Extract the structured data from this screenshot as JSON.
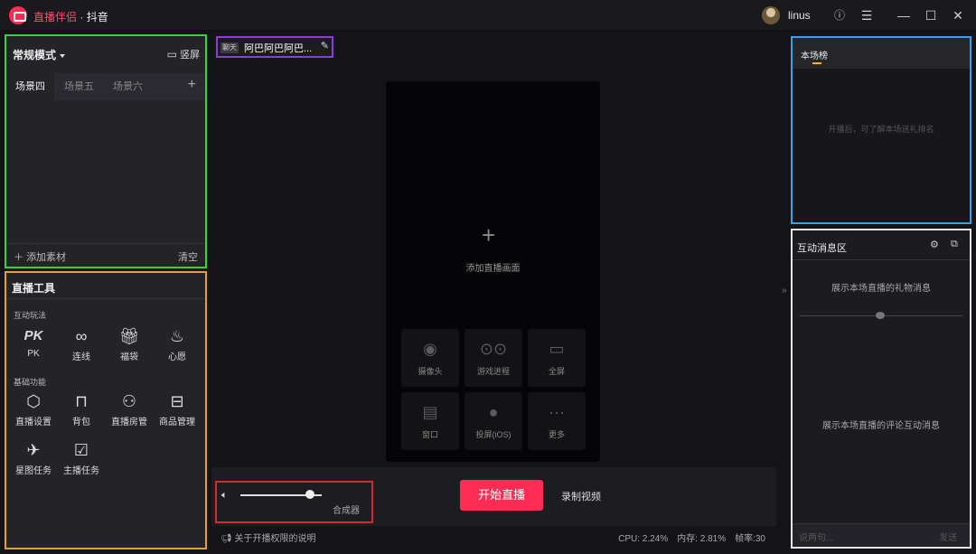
{
  "titlebar": {
    "app_name": "直播伴侣",
    "separator": " · ",
    "platform": "抖音",
    "username": "linus",
    "icons": [
      "help-icon",
      "menu-icon",
      "minimize-icon",
      "maximize-icon",
      "close-icon"
    ]
  },
  "scene": {
    "mode": "常规模式",
    "portrait_label": "竖屏",
    "tabs": [
      "场景四",
      "场景五",
      "场景六"
    ],
    "add_material": "添加素材",
    "clear": "清空"
  },
  "tools": {
    "title": "直播工具",
    "section_interactive": "互动玩法",
    "section_basic": "基础功能",
    "interactive": [
      {
        "label": "PK",
        "icon": "pk-icon"
      },
      {
        "label": "连线",
        "icon": "link-icon"
      },
      {
        "label": "福袋",
        "icon": "gift-bag-icon"
      },
      {
        "label": "心愿",
        "icon": "wish-icon"
      }
    ],
    "basic": [
      {
        "label": "直播设置",
        "icon": "settings-icon"
      },
      {
        "label": "背包",
        "icon": "backpack-icon"
      },
      {
        "label": "直播房管",
        "icon": "room-admin-icon"
      },
      {
        "label": "商品管理",
        "icon": "store-icon"
      },
      {
        "label": "星图任务",
        "icon": "star-task-icon"
      },
      {
        "label": "主播任务",
        "icon": "anchor-task-icon"
      }
    ]
  },
  "live_title": {
    "badge": "聊天",
    "title": "阿巴阿巴阿巴..."
  },
  "preview": {
    "add_scene": "添加直播画面",
    "sources": [
      "摄像头",
      "游戏进程",
      "全屏",
      "窗口",
      "投屏(iOS)",
      "更多"
    ]
  },
  "controls": {
    "mixer": "合成器",
    "volume_level": 0.85,
    "go_live": "开始直播",
    "record": "录制视频"
  },
  "status": {
    "notice": "关于开播权限的说明",
    "cpu": "CPU: 2.24%",
    "memory": "内存: 2.81%",
    "fps": "帧率:30"
  },
  "rank": {
    "title": "本场榜",
    "empty": "开播后，可了解本场送礼排名"
  },
  "messages": {
    "title": "互动消息区",
    "gift_note": "展示本场直播的礼物消息",
    "comment_note": "展示本场直播的评论互动消息",
    "input_placeholder": "说两句...",
    "send": "发送"
  },
  "colors": {
    "accent": "#fe2c55",
    "rank_underline": "#f5b600"
  }
}
